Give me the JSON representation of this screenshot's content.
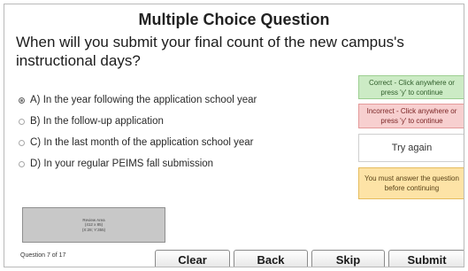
{
  "slide": {
    "title": "Multiple Choice Question",
    "question": "When will you submit your final count of the new campus's instructional days?",
    "choices": [
      {
        "label": "A) In the year following the application school year",
        "selected": true
      },
      {
        "label": "B) In the follow-up application",
        "selected": false
      },
      {
        "label": "C) In the last month of the application school year",
        "selected": false
      },
      {
        "label": "D) In your regular PEIMS fall submission",
        "selected": false
      }
    ],
    "feedback": {
      "correct": "Correct - Click anywhere or press 'y' to continue",
      "incorrect": "Incorrect - Click anywhere or press 'y' to continue",
      "try_again": "Try again",
      "must_answer": "You must answer the question before continuing"
    },
    "review_area": {
      "line1": "Review Area",
      "line2": "(412 x 85)",
      "line3": "(X:28; Y:355)"
    },
    "counter": "Question 7 of 17",
    "buttons": {
      "clear": "Clear",
      "back": "Back",
      "skip": "Skip",
      "submit": "Submit"
    }
  },
  "colors": {
    "correct_bg": "#ccebc5",
    "incorrect_bg": "#f7cfcf",
    "must_answer_bg": "#fde3a6",
    "review_bg": "#c8c8c8"
  }
}
